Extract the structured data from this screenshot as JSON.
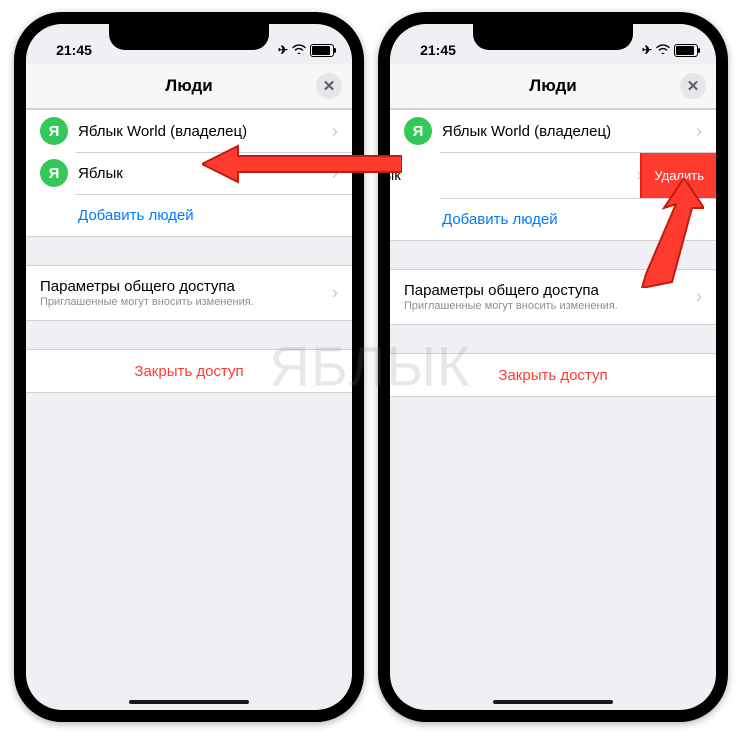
{
  "status": {
    "time": "21:45",
    "airplane": "✈",
    "wifi": "▾",
    "battery": "▮"
  },
  "header": {
    "title": "Люди",
    "close": "✕"
  },
  "people": {
    "owner_initial": "Я",
    "owner_name": "Яблык World (владелец)",
    "member_initial": "Я",
    "member_name": "Яблык",
    "add_label": "Добавить людей",
    "delete_label": "Удалить"
  },
  "params": {
    "title": "Параметры общего доступа",
    "subtitle": "Приглашенные могут вносить изменения."
  },
  "close_access": "Закрыть доступ",
  "chevron": "›",
  "watermark": "ЯБЛЫК"
}
